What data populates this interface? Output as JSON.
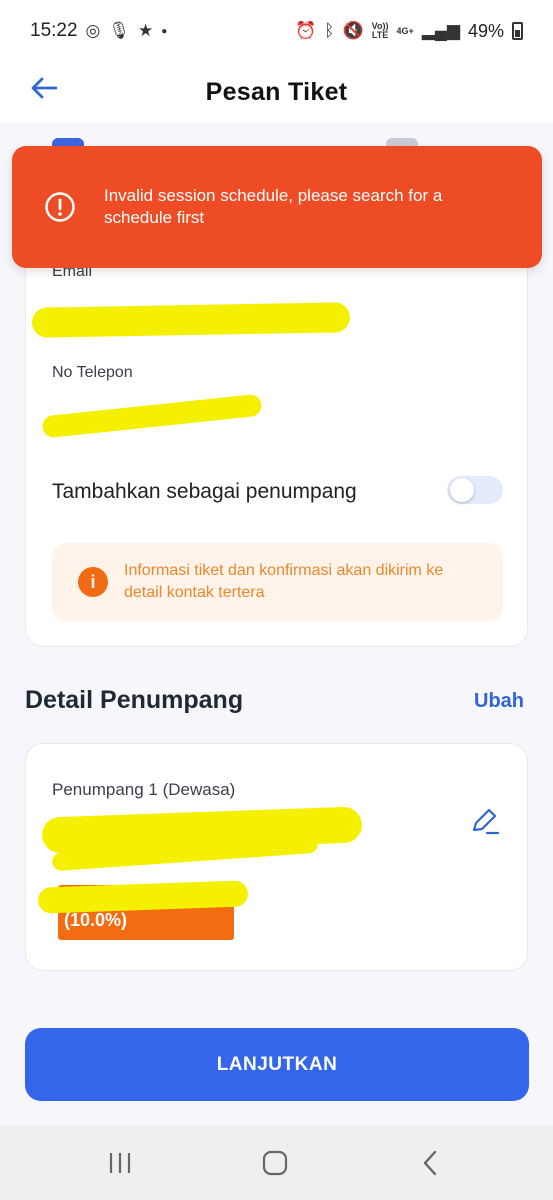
{
  "status_bar": {
    "time": "15:22",
    "battery": "49%",
    "network_top": "Vo))",
    "network_bottom": "LTE",
    "network_type": "4G+"
  },
  "header": {
    "title": "Pesan Tiket",
    "back_icon": "arrow-left-icon"
  },
  "toast": {
    "message": "Invalid session schedule, please search for a schedule first",
    "icon": "alert-circle-icon",
    "color": "#ee4c24"
  },
  "contact": {
    "email_label": "Email",
    "phone_label": "No Telepon",
    "add_passenger_label": "Tambahkan sebagai penumpang",
    "add_passenger_enabled": false,
    "info_text": "Informasi tiket dan konfirmasi akan dikirim ke detail kontak tertera"
  },
  "passenger_section": {
    "title": "Detail Penumpang",
    "edit_link": "Ubah",
    "passenger_label": "Penumpang 1 (Dewasa)",
    "badge_text": "(10.0%)"
  },
  "actions": {
    "continue_label": "LANJUTKAN"
  },
  "colors": {
    "primary": "#3366ea",
    "warning": "#f26b13",
    "error": "#ee4c24",
    "redaction": "#f5ef00"
  }
}
